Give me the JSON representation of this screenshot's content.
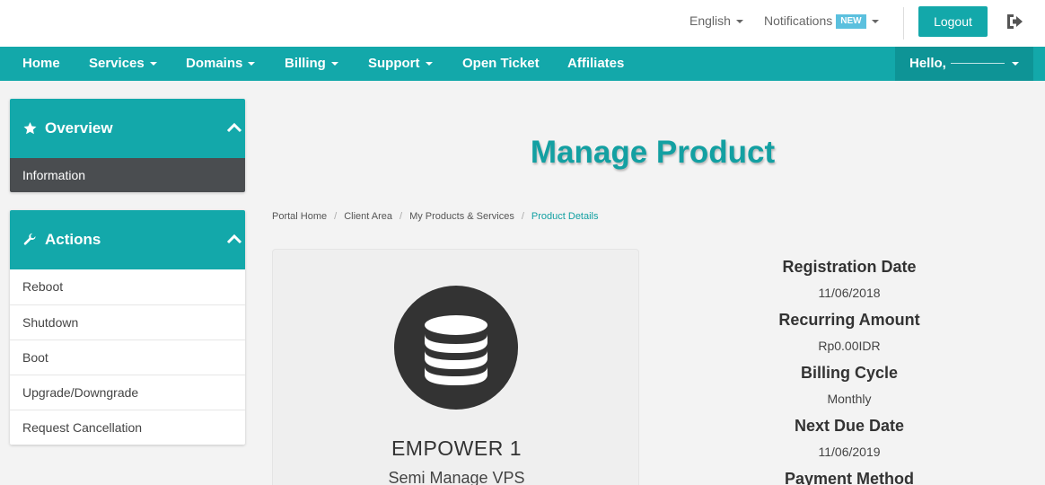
{
  "topbar": {
    "language_label": "English",
    "notifications_label": "Notifications",
    "notifications_badge": "NEW",
    "logout_label": "Logout"
  },
  "nav": {
    "home": "Home",
    "services": "Services",
    "domains": "Domains",
    "billing": "Billing",
    "support": "Support",
    "open_ticket": "Open Ticket",
    "affiliates": "Affiliates",
    "hello": "Hello,"
  },
  "sidebar": {
    "overview": {
      "title": "Overview",
      "icon": "star-icon",
      "items": [
        "Information"
      ]
    },
    "actions": {
      "title": "Actions",
      "icon": "wrench-icon",
      "items": [
        "Reboot",
        "Shutdown",
        "Boot",
        "Upgrade/Downgrade",
        "Request Cancellation"
      ]
    }
  },
  "main": {
    "title": "Manage Product",
    "breadcrumb": [
      "Portal Home",
      "Client Area",
      "My Products & Services",
      "Product Details"
    ],
    "product": {
      "icon": "database-icon",
      "name": "EMPOWER 1",
      "group": "Semi Manage VPS"
    },
    "details": [
      {
        "label": "Registration Date",
        "value": "11/06/2018"
      },
      {
        "label": "Recurring Amount",
        "value": "Rp0.00IDR"
      },
      {
        "label": "Billing Cycle",
        "value": "Monthly"
      },
      {
        "label": "Next Due Date",
        "value": "11/06/2019"
      },
      {
        "label": "Payment Method",
        "value": ""
      }
    ]
  },
  "colors": {
    "accent": "#13a8aa",
    "dark_row": "#4a4d50"
  }
}
